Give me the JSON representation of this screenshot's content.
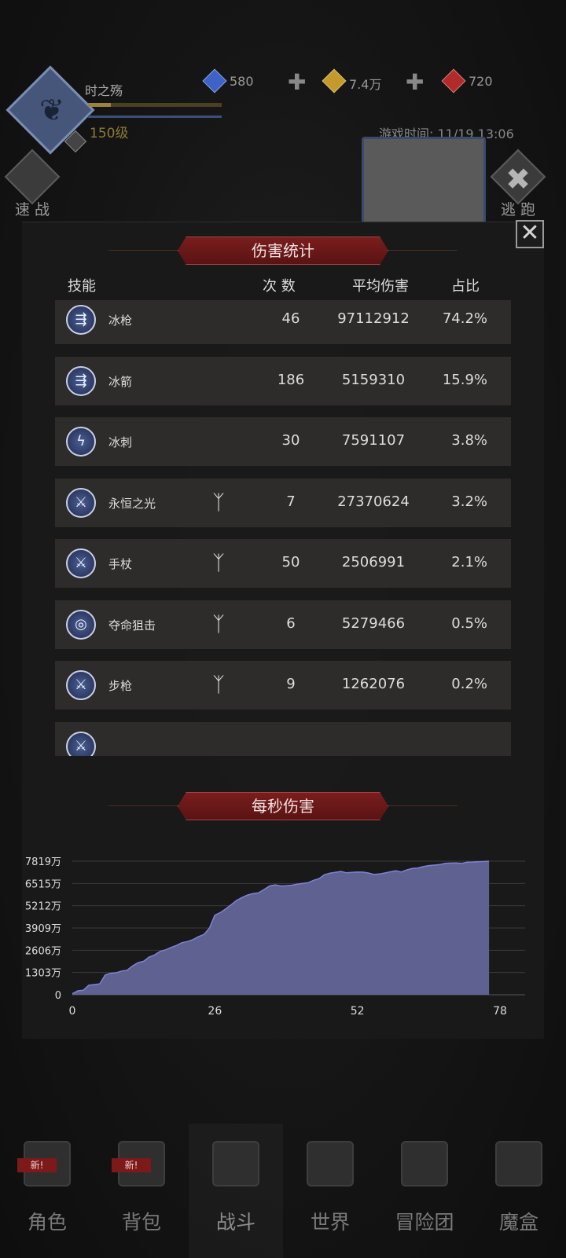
{
  "hud": {
    "player_name": "时之殇",
    "level": "150级",
    "exp_progress": 0.17,
    "resources": [
      {
        "value": "580",
        "color": "#3d63c6",
        "icon": "blue-gem-icon"
      },
      {
        "value": "7.4万",
        "color": "#c49a2a",
        "icon": "gold-coin-icon"
      },
      {
        "value": "720",
        "color": "#b32a2a",
        "icon": "red-gem-icon"
      }
    ],
    "game_time": "游戏时间: 11/19 13:06",
    "quick_battle": "速 战",
    "escape": "逃 跑"
  },
  "damage_stats": {
    "title": "伤害统计",
    "headers": {
      "skill": "技能",
      "count": "次 数",
      "avg": "平均伤害",
      "pct": "占比"
    },
    "rows": [
      {
        "name": "冰枪",
        "count": "46",
        "avg": "97112912",
        "pct": "74.2%",
        "icon": "ice-spear-icon",
        "glyph": "⇶",
        "badge": false
      },
      {
        "name": "冰箭",
        "count": "186",
        "avg": "5159310",
        "pct": "15.9%",
        "icon": "ice-arrow-icon",
        "glyph": "⇶",
        "badge": false
      },
      {
        "name": "冰刺",
        "count": "30",
        "avg": "7591107",
        "pct": "3.8%",
        "icon": "ice-spike-icon",
        "glyph": "ϟ",
        "badge": false
      },
      {
        "name": "永恒之光",
        "count": "7",
        "avg": "27370624",
        "pct": "3.2%",
        "icon": "sword-icon",
        "glyph": "⚔",
        "badge": true
      },
      {
        "name": "手杖",
        "count": "50",
        "avg": "2506991",
        "pct": "2.1%",
        "icon": "sword-icon",
        "glyph": "⚔",
        "badge": true
      },
      {
        "name": "夺命狙击",
        "count": "6",
        "avg": "5279466",
        "pct": "0.5%",
        "icon": "target-icon",
        "glyph": "◎",
        "badge": true
      },
      {
        "name": "步枪",
        "count": "9",
        "avg": "1262076",
        "pct": "0.2%",
        "icon": "sword-icon",
        "glyph": "⚔",
        "badge": true
      }
    ]
  },
  "dps": {
    "title": "每秒伤害"
  },
  "chart_data": {
    "type": "area",
    "title": "每秒伤害",
    "xlabel": "",
    "ylabel": "",
    "x_ticks": [
      "0",
      "26",
      "52",
      "78"
    ],
    "y_ticks": [
      "0",
      "1303万",
      "2606万",
      "3909万",
      "5212万",
      "6515万",
      "7819万"
    ],
    "xlim": [
      0,
      78
    ],
    "ylim": [
      0,
      7819
    ],
    "y_unit": "万",
    "grid": true,
    "fill_color": "#5f6290",
    "line_color": "#7d82d6",
    "series": [
      {
        "x": [
          0,
          1,
          2,
          3,
          4,
          5,
          6,
          7,
          8,
          9,
          10,
          11,
          12,
          13,
          14,
          15,
          16,
          17,
          18,
          19,
          20,
          21,
          22,
          23,
          24,
          25,
          26,
          27,
          28,
          29,
          30,
          31,
          32,
          33,
          34,
          35,
          36,
          37,
          38,
          39,
          40,
          41,
          42,
          43,
          44,
          45,
          46,
          47,
          48,
          49,
          50,
          51,
          52,
          53,
          54,
          55,
          56,
          57,
          58,
          59,
          60,
          61,
          62,
          63,
          64,
          65,
          66,
          67,
          68,
          69,
          70,
          71,
          72,
          73,
          74,
          75,
          76
        ],
        "values": [
          60,
          230,
          260,
          560,
          600,
          640,
          1160,
          1260,
          1290,
          1390,
          1440,
          1690,
          1880,
          1960,
          2210,
          2330,
          2540,
          2630,
          2770,
          2890,
          3050,
          3120,
          3230,
          3400,
          3530,
          3900,
          4660,
          4810,
          5030,
          5280,
          5530,
          5700,
          5840,
          5930,
          5970,
          6170,
          6370,
          6430,
          6370,
          6380,
          6410,
          6470,
          6520,
          6560,
          6700,
          6800,
          7030,
          7120,
          7170,
          7220,
          7140,
          7160,
          7190,
          7180,
          7130,
          7040,
          7070,
          7130,
          7200,
          7260,
          7190,
          7310,
          7390,
          7420,
          7500,
          7560,
          7590,
          7620,
          7690,
          7710,
          7720,
          7690,
          7760,
          7770,
          7790,
          7800,
          7819
        ]
      }
    ]
  },
  "nav": [
    {
      "label": "角色",
      "icon": "character-icon",
      "new": true,
      "new_label": "新!"
    },
    {
      "label": "背包",
      "icon": "backpack-icon",
      "new": true,
      "new_label": "新!"
    },
    {
      "label": "战斗",
      "icon": "battle-shield-icon",
      "new": false,
      "active": true
    },
    {
      "label": "世界",
      "icon": "world-map-icon",
      "new": false
    },
    {
      "label": "冒险团",
      "icon": "castle-icon",
      "new": false
    },
    {
      "label": "魔盒",
      "icon": "magic-box-icon",
      "new": false
    }
  ]
}
